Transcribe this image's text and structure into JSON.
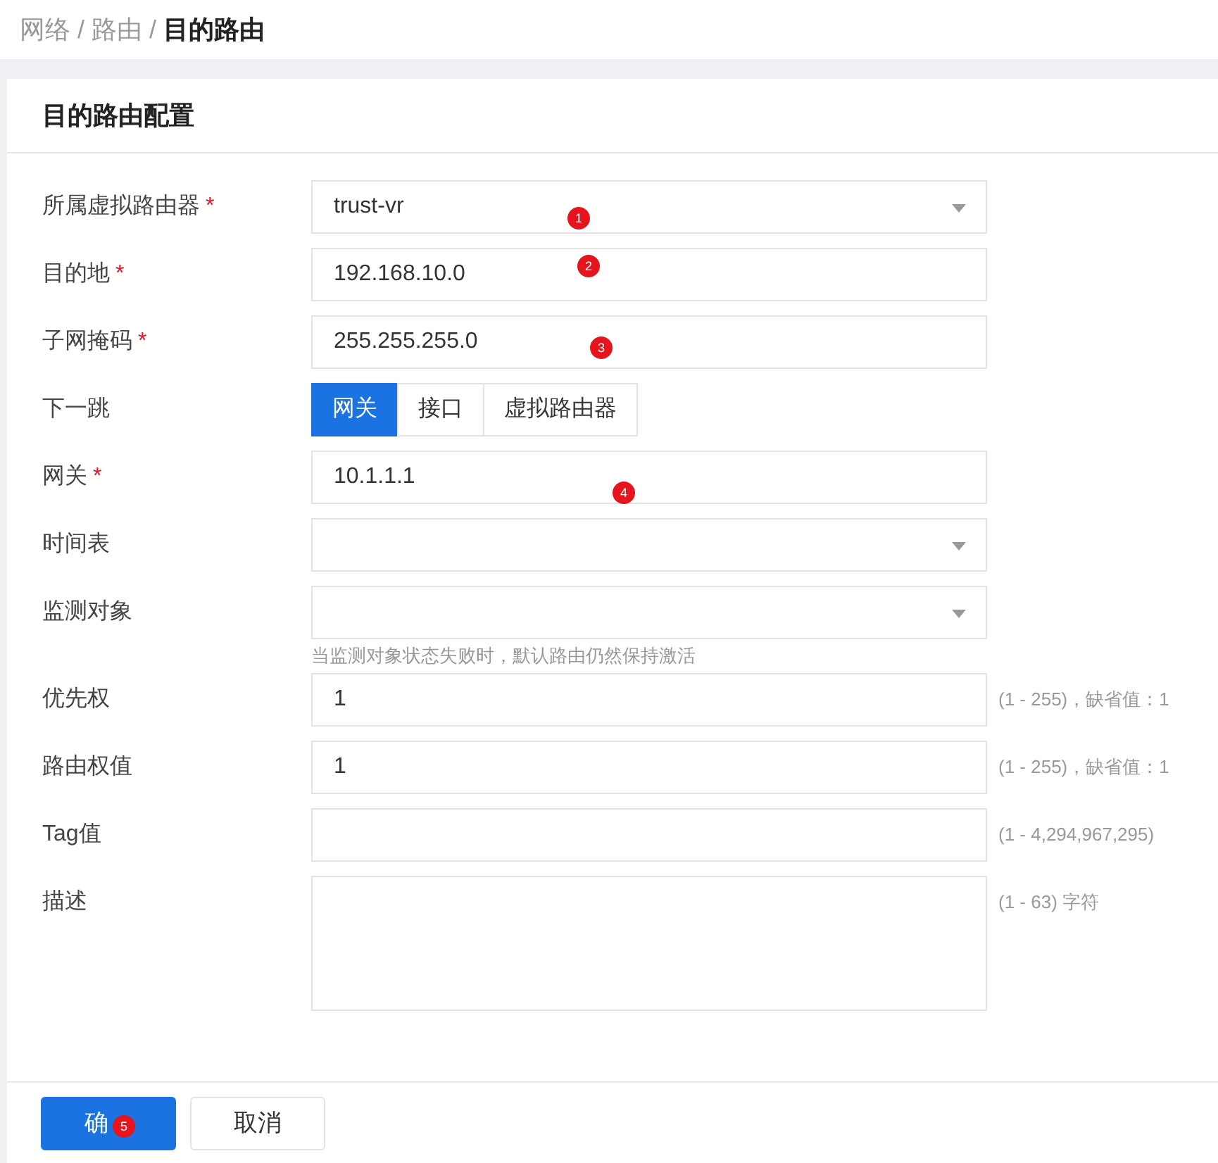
{
  "breadcrumb": [
    {
      "label": "网络",
      "current": false
    },
    {
      "separator": "/",
      "label": "路由",
      "current": false
    },
    {
      "separator": "/",
      "label": "目的路由",
      "current": true
    }
  ],
  "card_title": "目的路由配置",
  "fields": [
    {
      "kind": "select",
      "label": "所属虚拟路由器",
      "required_mark": "*",
      "value": "trust-vr",
      "marker": "1"
    },
    {
      "kind": "input",
      "label": "目的地",
      "required_mark": "*",
      "value": "192.168.10.0",
      "marker": "2"
    },
    {
      "kind": "input",
      "label": "子网掩码",
      "required_mark": "*",
      "value": "255.255.255.0",
      "marker": "3"
    },
    {
      "kind": "segmented",
      "label": "下一跳",
      "options": [
        {
          "label": "网关",
          "selected": true
        },
        {
          "label": "接口",
          "selected": false
        },
        {
          "label": "虚拟路由器",
          "selected": false
        }
      ]
    },
    {
      "kind": "input",
      "label": "网关",
      "required_mark": "*",
      "value": "10.1.1.1",
      "marker": "4"
    },
    {
      "kind": "select",
      "label": "时间表"
    },
    {
      "kind": "select",
      "label": "监测对象",
      "help": "当监测对象状态失败时，默认路由仍然保持激活"
    },
    {
      "kind": "input",
      "label": "优先权",
      "value": "1",
      "hint": "(1 - 255)，缺省值：1"
    },
    {
      "kind": "input",
      "label": "路由权值",
      "value": "1",
      "hint": "(1 - 255)，缺省值：1"
    },
    {
      "kind": "input",
      "label": "Tag值",
      "hint": "(1 - 4,294,967,295)"
    },
    {
      "kind": "textarea",
      "label": "描述",
      "hint": "(1 - 63) 字符"
    }
  ],
  "buttons": [
    {
      "label": "确",
      "primary": true,
      "marker": "5"
    },
    {
      "label": "取消",
      "primary": false
    }
  ]
}
